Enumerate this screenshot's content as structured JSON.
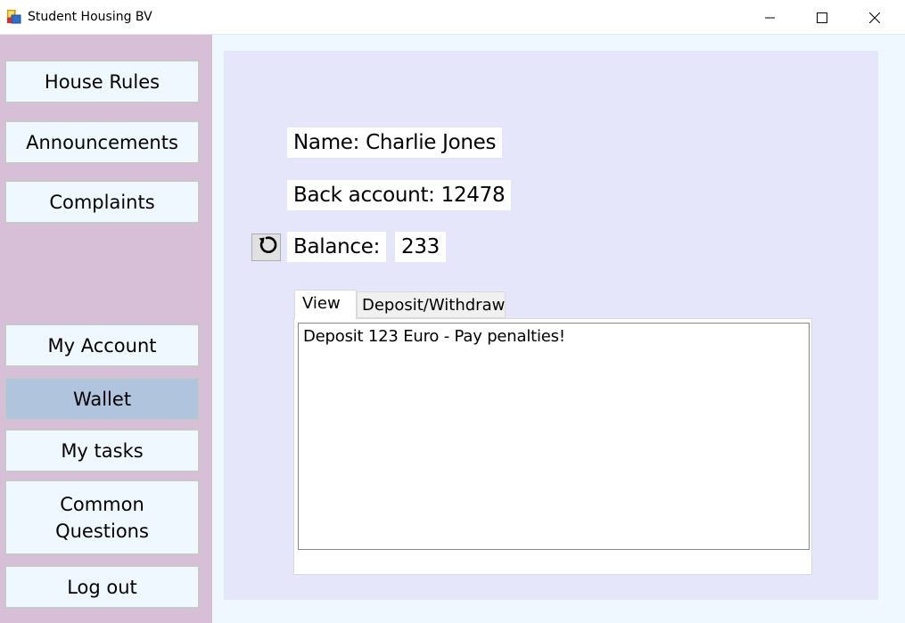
{
  "window": {
    "title": "Student Housing BV"
  },
  "sidebar": {
    "house_rules": "House Rules",
    "announcements": "Announcements",
    "complaints": "Complaints",
    "my_account": "My Account",
    "wallet": "Wallet",
    "my_tasks": "My tasks",
    "common_questions_line1": "Common",
    "common_questions_line2": "Questions",
    "log_out": "Log out",
    "active_item": "Wallet"
  },
  "account": {
    "name": "Name: Charlie Jones",
    "bank_account": "Back account: 12478",
    "balance_label": "Balance:",
    "balance_value": "233"
  },
  "tabs": {
    "view": "View",
    "deposit_withdraw": "Deposit/Withdraw",
    "selected": "View"
  },
  "transactions": [
    "Deposit 123 Euro - Pay penalties!"
  ],
  "colors": {
    "sidebar_bg": "#d8bfd8",
    "button_bg": "#f0f8ff",
    "active_button_bg": "#b0c4de",
    "panel_bg": "#e6e6fa"
  },
  "icons": {
    "app": "app-icon",
    "refresh": "refresh-icon",
    "minimize": "minimize-icon",
    "maximize": "maximize-icon",
    "close": "close-icon"
  }
}
